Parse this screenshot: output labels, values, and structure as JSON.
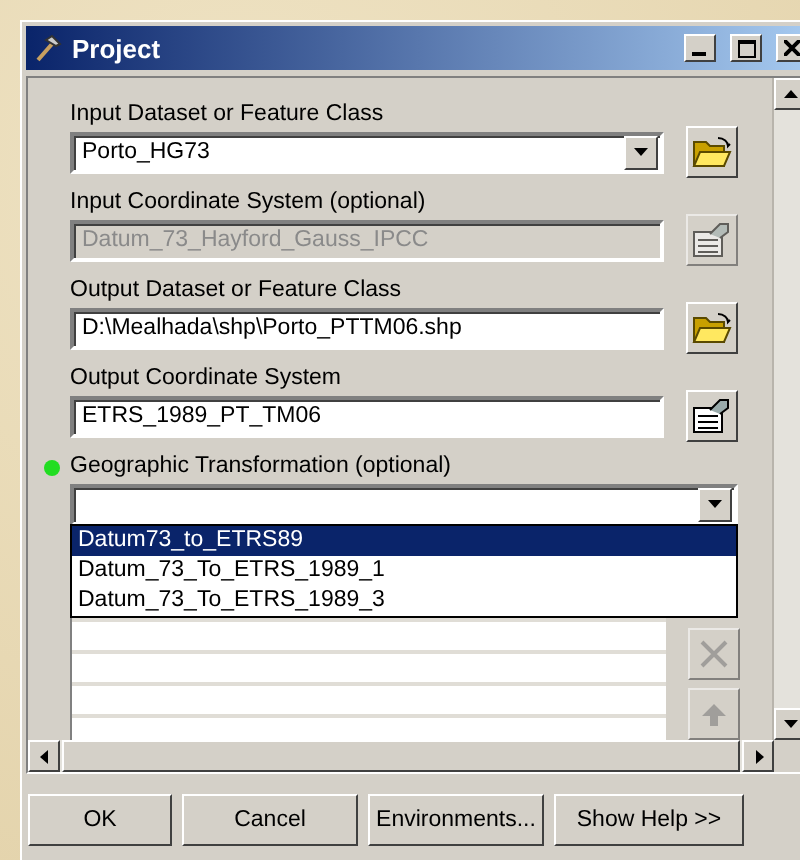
{
  "window": {
    "title": "Project"
  },
  "fields": [
    {
      "label": "Input Dataset or Feature Class",
      "value": "Porto_HG73",
      "dropdown": true,
      "disabled": false,
      "kind": "folder"
    },
    {
      "label": "Input Coordinate System (optional)",
      "value": "Datum_73_Hayford_Gauss_IPCC",
      "dropdown": false,
      "disabled": true,
      "kind": "properties"
    },
    {
      "label": "Output Dataset or Feature Class",
      "value": "D:\\Mealhada\\shp\\Porto_PTTM06.shp",
      "dropdown": false,
      "disabled": false,
      "kind": "folder"
    },
    {
      "label": "Output Coordinate System",
      "value": "ETRS_1989_PT_TM06",
      "dropdown": false,
      "disabled": false,
      "kind": "properties"
    }
  ],
  "transformation": {
    "label": "Geographic Transformation (optional)",
    "marked": true,
    "options": [
      {
        "label": "Datum73_to_ETRS89",
        "selected": true
      },
      {
        "label": "Datum_73_To_ETRS_1989_1",
        "selected": false
      },
      {
        "label": "Datum_73_To_ETRS_1989_3",
        "selected": false
      }
    ]
  },
  "buttons": [
    "OK",
    "Cancel",
    "Environments...",
    "Show Help >>"
  ]
}
